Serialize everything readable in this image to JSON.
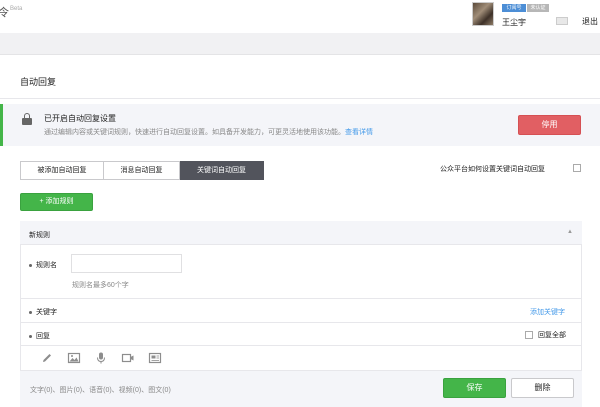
{
  "header": {
    "logo_glyph": "令",
    "beta_tag": "Beta",
    "badge_primary": "订阅号",
    "badge_secondary": "未认证",
    "username": "王尘宇",
    "logout_label": "退出"
  },
  "page": {
    "title": "自动回复"
  },
  "status": {
    "title": "已开启自动回复设置",
    "description": "通过编辑内容或关键词规则，快速进行自动回复设置。如具备开发能力，可更灵活地使用该功能。",
    "link_label": "查看详情",
    "disable_label": "停用"
  },
  "tabs": [
    {
      "label": "被添加自动回复",
      "active": false
    },
    {
      "label": "消息自动回复",
      "active": false
    },
    {
      "label": "关键词自动回复",
      "active": true
    }
  ],
  "how_to_label": "公众平台如何设置关键词自动回复",
  "add_rule_label": "添加规则",
  "rule": {
    "header_label": "新规则",
    "name_label": "规则名",
    "name_value": "",
    "name_hint": "规则名最多60个字",
    "keyword_label": "关键字",
    "add_keyword_label": "添加关键字",
    "reply_label": "回复",
    "reply_all_label": "回复全部",
    "reply_all_checked": false,
    "toolbar_icons": [
      "pencil-icon",
      "image-icon",
      "microphone-icon",
      "video-icon",
      "article-icon"
    ],
    "counts_text": "文字(0)、图片(0)、语音(0)、视频(0)、图文(0)",
    "save_label": "保存",
    "delete_label": "删除"
  },
  "colors": {
    "accent_green": "#44b549",
    "danger_red": "#e15f63",
    "link_blue": "#459ae9",
    "active_tab": "#52545c"
  }
}
